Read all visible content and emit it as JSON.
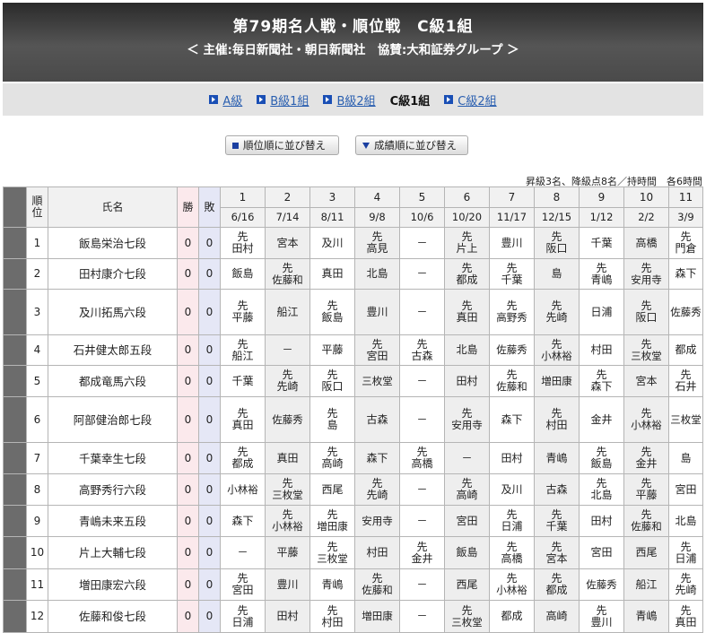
{
  "header": {
    "title": "第79期名人戦・順位戦　C級1組",
    "subtitle": "＜ 主催:毎日新聞社・朝日新聞社　協賛:大和証券グループ ＞"
  },
  "nav": [
    {
      "label": "A級",
      "current": false
    },
    {
      "label": "B級1組",
      "current": false
    },
    {
      "label": "B級2組",
      "current": false
    },
    {
      "label": "C級1組",
      "current": true
    },
    {
      "label": "C級2組",
      "current": false
    }
  ],
  "buttons": {
    "sort_rank": "順位順に並び替え",
    "sort_result": "成績順に並び替え"
  },
  "note": "昇級3名、降級点8名／持時間　各6時間",
  "table": {
    "headers": {
      "rank": "順位",
      "name": "氏名",
      "wins": "勝",
      "losses": "敗"
    },
    "rounds": [
      {
        "no": "1",
        "date": "6/16"
      },
      {
        "no": "2",
        "date": "7/14"
      },
      {
        "no": "3",
        "date": "8/11"
      },
      {
        "no": "4",
        "date": "9/8"
      },
      {
        "no": "5",
        "date": "10/6"
      },
      {
        "no": "6",
        "date": "10/20"
      },
      {
        "no": "7",
        "date": "11/17"
      },
      {
        "no": "8",
        "date": "12/15"
      },
      {
        "no": "9",
        "date": "1/12"
      },
      {
        "no": "10",
        "date": "2/2"
      },
      {
        "no": "11",
        "date": "3/9"
      }
    ],
    "first_move_mark": "先",
    "rows": [
      {
        "rank": "1",
        "name": "飯島栄治七段",
        "wins": "0",
        "losses": "0",
        "games": [
          {
            "first": true,
            "opp": "田村"
          },
          {
            "first": false,
            "opp": "宮本"
          },
          {
            "first": false,
            "opp": "及川"
          },
          {
            "first": true,
            "opp": "高見"
          },
          {
            "first": false,
            "opp": "－"
          },
          {
            "first": true,
            "opp": "片上"
          },
          {
            "first": false,
            "opp": "豊川"
          },
          {
            "first": true,
            "opp": "阪口"
          },
          {
            "first": false,
            "opp": "千葉"
          },
          {
            "first": false,
            "opp": "高橋"
          },
          {
            "first": true,
            "opp": "門倉"
          }
        ]
      },
      {
        "rank": "2",
        "name": "田村康介七段",
        "wins": "0",
        "losses": "0",
        "games": [
          {
            "first": false,
            "opp": "飯島"
          },
          {
            "first": true,
            "opp": "佐藤和"
          },
          {
            "first": false,
            "opp": "真田"
          },
          {
            "first": false,
            "opp": "北島"
          },
          {
            "first": false,
            "opp": "－"
          },
          {
            "first": true,
            "opp": "都成"
          },
          {
            "first": true,
            "opp": "千葉"
          },
          {
            "first": false,
            "opp": "島"
          },
          {
            "first": true,
            "opp": "青嶋"
          },
          {
            "first": true,
            "opp": "安用寺"
          },
          {
            "first": false,
            "opp": "森下"
          }
        ]
      },
      {
        "rank": "3",
        "name": "及川拓馬六段",
        "wins": "0",
        "losses": "0",
        "games": [
          {
            "first": true,
            "opp": "平藤"
          },
          {
            "first": false,
            "opp": "船江"
          },
          {
            "first": true,
            "opp": "飯島"
          },
          {
            "first": false,
            "opp": "豊川"
          },
          {
            "first": false,
            "opp": "－"
          },
          {
            "first": true,
            "opp": "真田"
          },
          {
            "first": true,
            "opp": "高野秀"
          },
          {
            "first": true,
            "opp": "先崎"
          },
          {
            "first": false,
            "opp": "日浦"
          },
          {
            "first": true,
            "opp": "阪口"
          },
          {
            "first": false,
            "opp": "佐藤秀"
          }
        ]
      },
      {
        "rank": "4",
        "name": "石井健太郎五段",
        "wins": "0",
        "losses": "0",
        "games": [
          {
            "first": true,
            "opp": "船江"
          },
          {
            "first": false,
            "opp": "－"
          },
          {
            "first": false,
            "opp": "平藤"
          },
          {
            "first": true,
            "opp": "宮田"
          },
          {
            "first": true,
            "opp": "古森"
          },
          {
            "first": false,
            "opp": "北島"
          },
          {
            "first": false,
            "opp": "佐藤秀"
          },
          {
            "first": true,
            "opp": "小林裕"
          },
          {
            "first": false,
            "opp": "村田"
          },
          {
            "first": true,
            "opp": "三枚堂"
          },
          {
            "first": false,
            "opp": "都成"
          }
        ]
      },
      {
        "rank": "5",
        "name": "都成竜馬六段",
        "wins": "0",
        "losses": "0",
        "games": [
          {
            "first": false,
            "opp": "千葉"
          },
          {
            "first": true,
            "opp": "先崎"
          },
          {
            "first": true,
            "opp": "阪口"
          },
          {
            "first": false,
            "opp": "三枚堂"
          },
          {
            "first": false,
            "opp": "－"
          },
          {
            "first": false,
            "opp": "田村"
          },
          {
            "first": true,
            "opp": "佐藤和"
          },
          {
            "first": false,
            "opp": "増田康"
          },
          {
            "first": true,
            "opp": "森下"
          },
          {
            "first": false,
            "opp": "宮本"
          },
          {
            "first": true,
            "opp": "石井"
          }
        ]
      },
      {
        "rank": "6",
        "name": "阿部健治郎七段",
        "wins": "0",
        "losses": "0",
        "games": [
          {
            "first": true,
            "opp": "真田"
          },
          {
            "first": false,
            "opp": "佐藤秀"
          },
          {
            "first": true,
            "opp": "島"
          },
          {
            "first": false,
            "opp": "古森"
          },
          {
            "first": false,
            "opp": "－"
          },
          {
            "first": true,
            "opp": "安用寺"
          },
          {
            "first": false,
            "opp": "森下"
          },
          {
            "first": true,
            "opp": "村田"
          },
          {
            "first": false,
            "opp": "金井"
          },
          {
            "first": true,
            "opp": "小林裕"
          },
          {
            "first": false,
            "opp": "三枚堂"
          }
        ]
      },
      {
        "rank": "7",
        "name": "千葉幸生七段",
        "wins": "0",
        "losses": "0",
        "games": [
          {
            "first": true,
            "opp": "都成"
          },
          {
            "first": false,
            "opp": "真田"
          },
          {
            "first": true,
            "opp": "高崎"
          },
          {
            "first": false,
            "opp": "森下"
          },
          {
            "first": true,
            "opp": "高橋"
          },
          {
            "first": false,
            "opp": "－"
          },
          {
            "first": false,
            "opp": "田村"
          },
          {
            "first": false,
            "opp": "青嶋"
          },
          {
            "first": true,
            "opp": "飯島"
          },
          {
            "first": true,
            "opp": "金井"
          },
          {
            "first": false,
            "opp": "島"
          }
        ]
      },
      {
        "rank": "8",
        "name": "高野秀行六段",
        "wins": "0",
        "losses": "0",
        "games": [
          {
            "first": false,
            "opp": "小林裕"
          },
          {
            "first": true,
            "opp": "三枚堂"
          },
          {
            "first": false,
            "opp": "西尾"
          },
          {
            "first": true,
            "opp": "先崎"
          },
          {
            "first": false,
            "opp": "－"
          },
          {
            "first": true,
            "opp": "高崎"
          },
          {
            "first": false,
            "opp": "及川"
          },
          {
            "first": false,
            "opp": "古森"
          },
          {
            "first": true,
            "opp": "北島"
          },
          {
            "first": true,
            "opp": "平藤"
          },
          {
            "first": false,
            "opp": "宮田"
          }
        ]
      },
      {
        "rank": "9",
        "name": "青嶋未来五段",
        "wins": "0",
        "losses": "0",
        "games": [
          {
            "first": false,
            "opp": "森下"
          },
          {
            "first": true,
            "opp": "小林裕"
          },
          {
            "first": true,
            "opp": "増田康"
          },
          {
            "first": false,
            "opp": "安用寺"
          },
          {
            "first": false,
            "opp": "－"
          },
          {
            "first": false,
            "opp": "宮田"
          },
          {
            "first": true,
            "opp": "日浦"
          },
          {
            "first": true,
            "opp": "千葉"
          },
          {
            "first": false,
            "opp": "田村"
          },
          {
            "first": true,
            "opp": "佐藤和"
          },
          {
            "first": false,
            "opp": "北島"
          }
        ]
      },
      {
        "rank": "10",
        "name": "片上大輔七段",
        "wins": "0",
        "losses": "0",
        "games": [
          {
            "first": false,
            "opp": "－"
          },
          {
            "first": false,
            "opp": "平藤"
          },
          {
            "first": true,
            "opp": "三枚堂"
          },
          {
            "first": false,
            "opp": "村田"
          },
          {
            "first": true,
            "opp": "金井"
          },
          {
            "first": false,
            "opp": "飯島"
          },
          {
            "first": true,
            "opp": "高橋"
          },
          {
            "first": true,
            "opp": "宮本"
          },
          {
            "first": false,
            "opp": "宮田"
          },
          {
            "first": false,
            "opp": "西尾"
          },
          {
            "first": true,
            "opp": "日浦"
          }
        ]
      },
      {
        "rank": "11",
        "name": "増田康宏六段",
        "wins": "0",
        "losses": "0",
        "games": [
          {
            "first": true,
            "opp": "宮田"
          },
          {
            "first": false,
            "opp": "豊川"
          },
          {
            "first": false,
            "opp": "青嶋"
          },
          {
            "first": true,
            "opp": "佐藤和"
          },
          {
            "first": false,
            "opp": "－"
          },
          {
            "first": false,
            "opp": "西尾"
          },
          {
            "first": true,
            "opp": "小林裕"
          },
          {
            "first": true,
            "opp": "都成"
          },
          {
            "first": false,
            "opp": "佐藤秀"
          },
          {
            "first": false,
            "opp": "船江"
          },
          {
            "first": true,
            "opp": "先崎"
          }
        ]
      },
      {
        "rank": "12",
        "name": "佐藤和俊七段",
        "wins": "0",
        "losses": "0",
        "games": [
          {
            "first": true,
            "opp": "日浦"
          },
          {
            "first": false,
            "opp": "田村"
          },
          {
            "first": true,
            "opp": "村田"
          },
          {
            "first": false,
            "opp": "増田康"
          },
          {
            "first": false,
            "opp": "－"
          },
          {
            "first": true,
            "opp": "三枚堂"
          },
          {
            "first": false,
            "opp": "都成"
          },
          {
            "first": false,
            "opp": "高崎"
          },
          {
            "first": true,
            "opp": "豊川"
          },
          {
            "first": false,
            "opp": "青嶋"
          },
          {
            "first": true,
            "opp": "真田"
          }
        ]
      }
    ]
  }
}
